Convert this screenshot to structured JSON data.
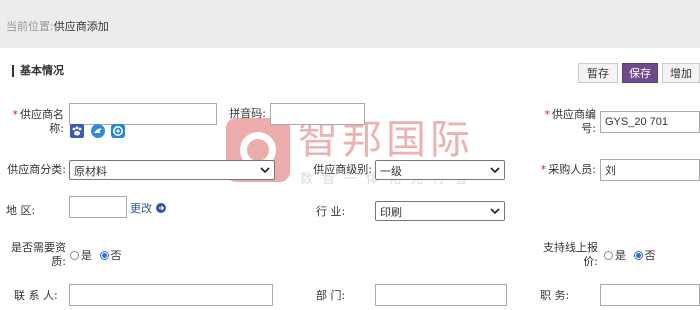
{
  "breadcrumb": {
    "label": "当前位置:",
    "current": "供应商添加"
  },
  "section": {
    "title": "基本情况"
  },
  "toolbar": {
    "draft_label": "暂存",
    "save_label": "保存",
    "add_label": "增加"
  },
  "form": {
    "supplier_name": {
      "label_line1": "供应商名",
      "label_line2": "称:",
      "value": ""
    },
    "pinyin": {
      "label": "拼音码:",
      "value": ""
    },
    "supplier_code": {
      "label_line1": "供应商编",
      "label_line2": "号:",
      "value": "GYS_20 701"
    },
    "supplier_category": {
      "label": "供应商分类:",
      "value": "原材料"
    },
    "supplier_level": {
      "label": "供应商级别:",
      "value": "一级"
    },
    "buyer": {
      "label": "采购人员:",
      "value": "刘"
    },
    "region": {
      "label": "地 区:",
      "value": "",
      "change_link": "更改"
    },
    "industry": {
      "label": "行 业:",
      "value": "印刷"
    },
    "needs_qualification": {
      "label_line1": "是否需要资",
      "label_line2": "质:",
      "opt_yes": "是",
      "opt_no": "否",
      "selected": "否"
    },
    "online_quote": {
      "label_line1": "支持线上报",
      "label_line2": "价:",
      "opt_yes": "是",
      "opt_no": "否",
      "selected": "否"
    },
    "contact": {
      "label": "联 系 人:",
      "value": ""
    },
    "department": {
      "label": "部 门:",
      "value": ""
    },
    "position": {
      "label": "职 务:",
      "value": ""
    }
  },
  "icons": [
    "paw-icon",
    "bird-icon",
    "circle-e-icon",
    "arrow-right-circle-icon"
  ],
  "watermark": {
    "title": "智邦国际",
    "subtitle": "数智一体化先行者"
  },
  "colors": {
    "primary_button": "#6f4b8b",
    "required_star": "#d22222",
    "link": "#2a5aa8",
    "radio_checked": "#2f6fd6",
    "watermark": "#e06a6a"
  }
}
